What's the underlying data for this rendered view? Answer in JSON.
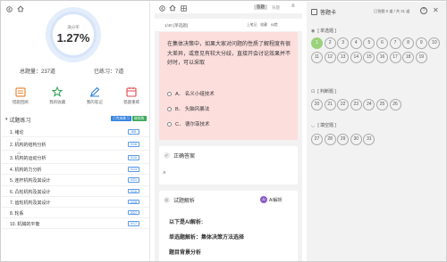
{
  "left": {
    "accuracy_label": "满分率",
    "accuracy_value": "1.27%",
    "total": "总题量：237道",
    "done": "已练习：7道",
    "tools": [
      {
        "label": "错题回顾",
        "color": "#e58a3a",
        "icon": "folder-icon"
      },
      {
        "label": "我的收藏",
        "color": "#3aa85c",
        "icon": "star-icon"
      },
      {
        "label": "我的笔记",
        "color": "#2f7fe0",
        "icon": "pen-icon"
      },
      {
        "label": "错题重练",
        "color": "#e0474c",
        "icon": "calendar-icon"
      }
    ],
    "section_title": "试题练习",
    "badge_blue": "已完成练习",
    "badge_green": "继续练习",
    "chapters": [
      {
        "name": "1. 绪论",
        "count": "8/8"
      },
      {
        "name": "2. 机构的结构分析",
        "count": "0/16",
        "sub": "15"
      },
      {
        "name": "3. 机构的运动分析",
        "count": "0/10",
        "sub": "23"
      },
      {
        "name": "4. 机构的力分析",
        "count": "0/13"
      },
      {
        "name": "5. 连杆机构及其设计",
        "count": "0/21"
      },
      {
        "name": "6. 凸轮机构及其设计",
        "count": "0/16"
      },
      {
        "name": "7. 齿轮机构及其设计",
        "count": "0/28"
      },
      {
        "name": "8. 轮系",
        "count": "0/27"
      },
      {
        "name": "10. 机械的平衡",
        "count": "0/17"
      }
    ]
  },
  "middle": {
    "tab_active": "答题",
    "tab_inactive": "背题",
    "question_number": "1/40  [单选题]",
    "actions": [
      "上笔记",
      "收藏",
      "纠错"
    ],
    "question_text": "在集体决策中，如果大家对问题的性质了解程度有很大差异，或意见有较大分歧，直接开会讨论效果并不好时，可以采取",
    "options": [
      "A． 名义小组技术",
      "B． 头脑风暴法",
      "C． 德尔菲技术"
    ],
    "answer_title": "正确答案",
    "analysis_title": "试题解析",
    "ai_label": "AI解析",
    "analysis_lines": [
      "以下是AI解析:",
      "单选题解析：集体决策方法选择",
      "题目背景分析"
    ]
  },
  "right": {
    "title": "答题卡",
    "info": "已答题 0 道 / 共 31 道",
    "groups": [
      {
        "label": "[ 单选题 ]",
        "icon": "radio-icon",
        "numbers": [
          "1",
          "2",
          "3",
          "4",
          "5",
          "6",
          "7",
          "8",
          "9",
          "10",
          "11",
          "12",
          "13",
          "14",
          "15",
          "16",
          "17",
          "18",
          "19"
        ]
      },
      {
        "label": "[ 判断题 ]",
        "icon": "checkbox-icon",
        "numbers": [
          "20",
          "21",
          "22",
          "23",
          "24",
          "25",
          "26"
        ]
      },
      {
        "label": "[ 填空题 ]",
        "icon": "blank-icon",
        "numbers": [
          "27",
          "28",
          "29",
          "30",
          "31"
        ]
      }
    ],
    "current": "1"
  }
}
